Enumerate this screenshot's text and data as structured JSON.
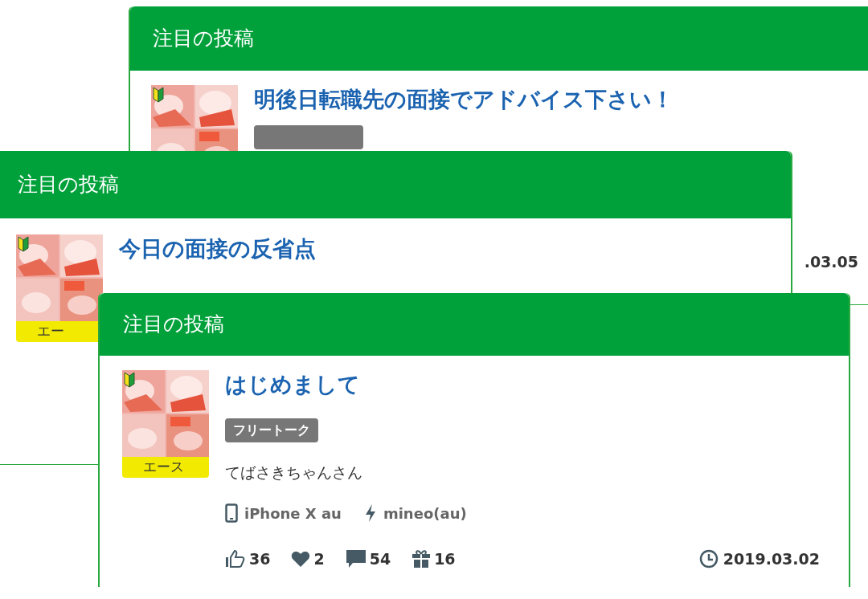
{
  "cards": [
    {
      "header": "注目の投稿",
      "title": "明後日転職先の面接でアドバイス下さい！",
      "beginner": true,
      "tag_stub": true,
      "date": ".03.05"
    },
    {
      "header": "注目の投稿",
      "title": "今日の面接の反省点",
      "beginner": true,
      "rank": "エー"
    },
    {
      "header": "注目の投稿",
      "title": "はじめまして",
      "beginner": true,
      "tag": "フリートーク",
      "rank": "エース",
      "user": "てばさきちゃんさん",
      "device": "iPhone X au",
      "carrier": "mineo(au)",
      "stats": [
        {
          "kind": "like",
          "count": "36"
        },
        {
          "kind": "heart",
          "count": "2"
        },
        {
          "kind": "comment",
          "count": "54"
        },
        {
          "kind": "gift",
          "count": "16"
        }
      ],
      "date": "2019.03.02"
    }
  ]
}
